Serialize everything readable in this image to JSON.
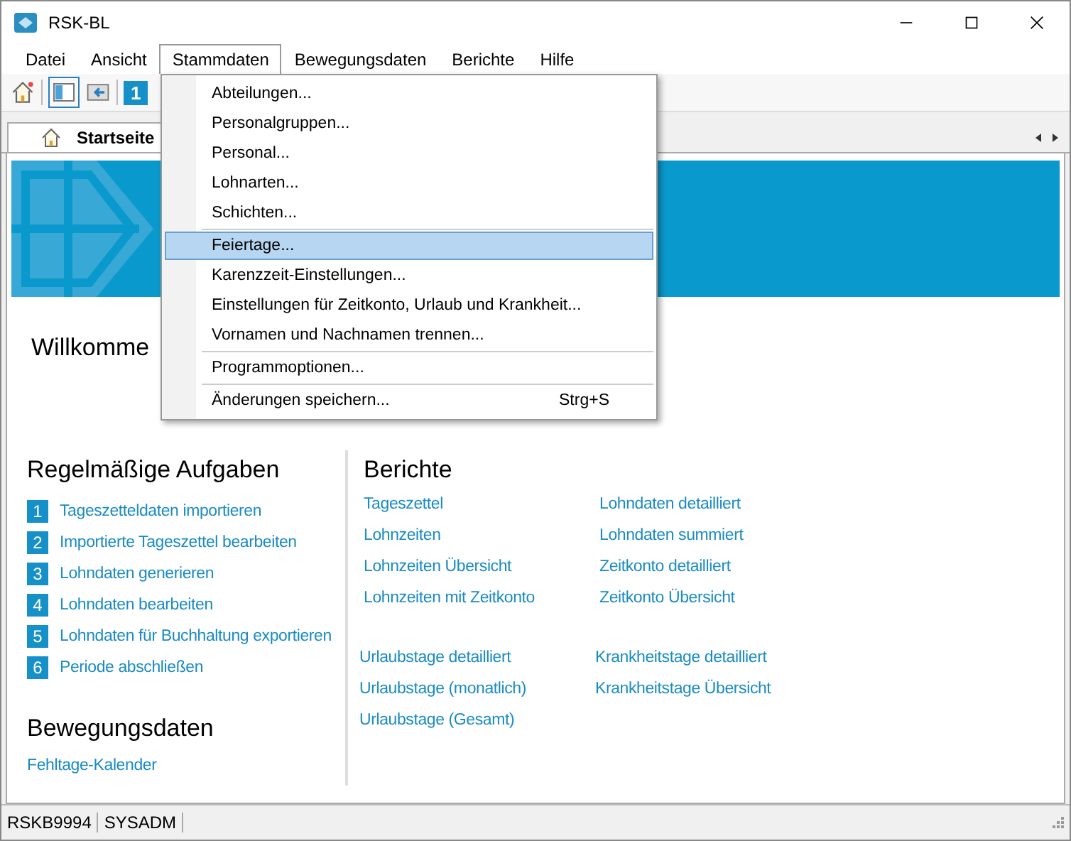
{
  "window": {
    "title": "RSK-BL"
  },
  "menubar": [
    {
      "label": "Datei",
      "selected": false
    },
    {
      "label": "Ansicht",
      "selected": false
    },
    {
      "label": "Stammdaten",
      "selected": true
    },
    {
      "label": "Bewegungsdaten",
      "selected": false
    },
    {
      "label": "Berichte",
      "selected": false
    },
    {
      "label": "Hilfe",
      "selected": false
    }
  ],
  "toolbar": {
    "badge": "1"
  },
  "tabs": [
    {
      "label": "Startseite",
      "selected": true
    }
  ],
  "menu": [
    {
      "kind": "item",
      "label": "Abteilungen...",
      "selected": false
    },
    {
      "kind": "item",
      "label": "Personalgruppen...",
      "selected": false
    },
    {
      "kind": "item",
      "label": "Personal...",
      "selected": false
    },
    {
      "kind": "item",
      "label": "Lohnarten...",
      "selected": false
    },
    {
      "kind": "item",
      "label": "Schichten...",
      "selected": false
    },
    {
      "kind": "separator"
    },
    {
      "kind": "item",
      "label": "Feiertage...",
      "selected": true
    },
    {
      "kind": "item",
      "label": "Karenzzeit-Einstellungen...",
      "selected": false
    },
    {
      "kind": "item",
      "label": "Einstellungen für Zeitkonto, Urlaub und Krankheit...",
      "selected": false
    },
    {
      "kind": "item",
      "label": "Vornamen und Nachnamen trennen...",
      "selected": false
    },
    {
      "kind": "separator"
    },
    {
      "kind": "item",
      "label": "Programmoptionen...",
      "selected": false
    },
    {
      "kind": "separator"
    },
    {
      "kind": "item",
      "label": "Änderungen speichern...",
      "shortcut": "Strg+S",
      "selected": false
    }
  ],
  "welcome": "Willkomme",
  "tasks": {
    "title": "Regelmäßige Aufgaben",
    "items": [
      {
        "number": "1",
        "label": "Tageszetteldaten importieren"
      },
      {
        "number": "2",
        "label": "Importierte Tageszettel bearbeiten"
      },
      {
        "number": "3",
        "label": "Lohndaten generieren"
      },
      {
        "number": "4",
        "label": "Lohndaten bearbeiten"
      },
      {
        "number": "5",
        "label": "Lohndaten für Buchhaltung exportieren"
      },
      {
        "number": "6",
        "label": "Periode abschließen"
      }
    ]
  },
  "movements": {
    "title": "Bewegungsdaten",
    "items": [
      "Fehltage-Kalender"
    ]
  },
  "reports": {
    "title": "Berichte",
    "groups": [
      {
        "column_1": [
          "Tageszettel",
          "Lohnzeiten",
          "Lohnzeiten Übersicht",
          "Lohnzeiten mit Zeitkonto"
        ],
        "column_2": [
          "Lohndaten detailliert",
          "Lohndaten summiert",
          "Zeitkonto detailliert",
          "Zeitkonto Übersicht"
        ]
      },
      {
        "column_1": [
          "Urlaubstage detailliert",
          "Urlaubstage (monatlich)",
          "Urlaubstage (Gesamt)"
        ],
        "column_2": [
          "Krankheitstage detailliert",
          "Krankheitstage Übersicht"
        ]
      }
    ]
  },
  "status_bar": [
    "RSKB9994",
    "SYSADM"
  ]
}
